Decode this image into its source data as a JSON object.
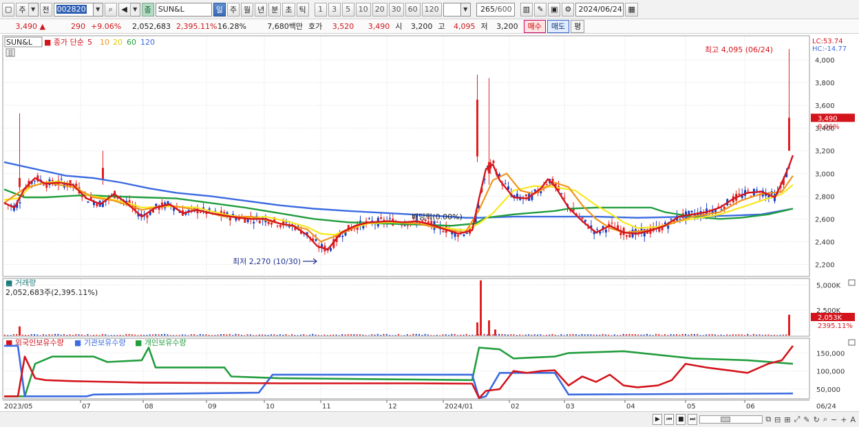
{
  "toolbar": {
    "mode_a": "주",
    "mode_b": "전",
    "stock_code": "002820",
    "type_badge": "종",
    "stock_name": "SUN&L",
    "periods": [
      "일",
      "주",
      "월",
      "년",
      "분",
      "초",
      "틱"
    ],
    "intervals": [
      "1",
      "3",
      "5",
      "10",
      "20",
      "30",
      "60",
      "120"
    ],
    "count": "265",
    "count_total": "/600",
    "date": "2024/06/24"
  },
  "quote": {
    "price": "3,490",
    "change": "290",
    "change_pct": "+9.06%",
    "volume": "2,052,683",
    "volume_pct": "2,395.11%",
    "turnover": "16.28%",
    "amount": "7,680백만",
    "ask_label": "호가",
    "ask": "3,520",
    "bid": "3,490",
    "open_label": "시",
    "open": "3,200",
    "high_label": "고",
    "high": "4,095",
    "low_label": "저",
    "low": "3,200",
    "buy": "매수",
    "sell": "매도",
    "avg": "평"
  },
  "legend": {
    "name": "SUN&L",
    "ma_title": "종가 단순",
    "ma": [
      {
        "period": "5",
        "color": "#d4141c"
      },
      {
        "period": "10",
        "color": "#f0941d"
      },
      {
        "period": "20",
        "color": "#f7e81e"
      },
      {
        "period": "60",
        "color": "#219d3c"
      },
      {
        "period": "120",
        "color": "#3a6ae0"
      }
    ]
  },
  "right_labels": {
    "lc": "LC:53.74",
    "hc": "HC:-14.77",
    "price_tag": "3,490",
    "pct_tag": "9.06%",
    "vol_tag": "2,053K",
    "vol_pct_tag": "2395.11%"
  },
  "annotations": {
    "high": "최고 4,095 (06/24)",
    "low": "최저 2,270 (10/30)",
    "dividend": "배당락(0.00%)"
  },
  "volume_panel": {
    "title": "거래량",
    "value": "2,052,683주(2,395.11%)",
    "ticks": [
      "5,000K",
      "2,500K"
    ]
  },
  "holding_panel": {
    "series": [
      {
        "name": "외국인보유수량",
        "color": "#d4141c"
      },
      {
        "name": "기관보유수량",
        "color": "#3a6ae0"
      },
      {
        "name": "개인보유수량",
        "color": "#219d3c"
      }
    ],
    "ticks": [
      "150,000",
      "100,000",
      "50,000"
    ]
  },
  "x_axis": [
    "2023/05",
    "07",
    "08",
    "09",
    "10",
    "11",
    "12",
    "2024/01",
    "02",
    "03",
    "04",
    "05",
    "06",
    "06/24"
  ],
  "chart_data": {
    "type": "candlestick",
    "price_axis": {
      "ticks": [
        4000,
        3800,
        3600,
        3400,
        3200,
        3000,
        2800,
        2600,
        2400,
        2200
      ],
      "ylim": [
        2100,
        4200
      ]
    },
    "ma120": [
      [
        0,
        3100
      ],
      [
        30,
        3060
      ],
      [
        60,
        3020
      ],
      [
        90,
        2980
      ],
      [
        130,
        2960
      ],
      [
        170,
        2920
      ],
      [
        210,
        2870
      ],
      [
        250,
        2830
      ],
      [
        300,
        2800
      ],
      [
        350,
        2760
      ],
      [
        400,
        2720
      ],
      [
        450,
        2690
      ],
      [
        500,
        2670
      ],
      [
        560,
        2650
      ],
      [
        620,
        2630
      ],
      [
        670,
        2610
      ],
      [
        690,
        2610
      ],
      [
        740,
        2620
      ],
      [
        800,
        2620
      ],
      [
        860,
        2620
      ],
      [
        920,
        2610
      ],
      [
        1000,
        2620
      ],
      [
        1060,
        2630
      ],
      [
        1100,
        2640
      ],
      [
        1146,
        2690
      ]
    ],
    "ma60": [
      [
        0,
        2860
      ],
      [
        30,
        2790
      ],
      [
        60,
        2790
      ],
      [
        90,
        2800
      ],
      [
        120,
        2810
      ],
      [
        150,
        2800
      ],
      [
        200,
        2790
      ],
      [
        250,
        2780
      ],
      [
        300,
        2740
      ],
      [
        350,
        2700
      ],
      [
        400,
        2650
      ],
      [
        450,
        2600
      ],
      [
        500,
        2570
      ],
      [
        550,
        2560
      ],
      [
        600,
        2550
      ],
      [
        650,
        2540
      ],
      [
        685,
        2560
      ],
      [
        700,
        2610
      ],
      [
        740,
        2640
      ],
      [
        800,
        2670
      ],
      [
        820,
        2690
      ],
      [
        860,
        2700
      ],
      [
        900,
        2700
      ],
      [
        940,
        2700
      ],
      [
        960,
        2660
      ],
      [
        1000,
        2620
      ],
      [
        1040,
        2600
      ],
      [
        1070,
        2610
      ],
      [
        1110,
        2640
      ],
      [
        1146,
        2690
      ]
    ],
    "ma20": [
      [
        0,
        2770
      ],
      [
        20,
        2780
      ],
      [
        40,
        2890
      ],
      [
        60,
        2920
      ],
      [
        80,
        2930
      ],
      [
        100,
        2900
      ],
      [
        120,
        2810
      ],
      [
        150,
        2780
      ],
      [
        180,
        2740
      ],
      [
        200,
        2700
      ],
      [
        240,
        2710
      ],
      [
        280,
        2700
      ],
      [
        320,
        2640
      ],
      [
        350,
        2610
      ],
      [
        380,
        2620
      ],
      [
        410,
        2580
      ],
      [
        440,
        2530
      ],
      [
        460,
        2470
      ],
      [
        480,
        2460
      ],
      [
        500,
        2510
      ],
      [
        530,
        2560
      ],
      [
        560,
        2570
      ],
      [
        600,
        2560
      ],
      [
        640,
        2520
      ],
      [
        670,
        2500
      ],
      [
        690,
        2560
      ],
      [
        710,
        2650
      ],
      [
        740,
        2850
      ],
      [
        770,
        2890
      ],
      [
        800,
        2880
      ],
      [
        830,
        2850
      ],
      [
        860,
        2720
      ],
      [
        880,
        2650
      ],
      [
        900,
        2570
      ],
      [
        920,
        2520
      ],
      [
        950,
        2530
      ],
      [
        980,
        2580
      ],
      [
        1000,
        2600
      ],
      [
        1040,
        2640
      ],
      [
        1080,
        2720
      ],
      [
        1110,
        2780
      ],
      [
        1130,
        2820
      ],
      [
        1146,
        2900
      ]
    ],
    "ma10": [
      [
        0,
        2740
      ],
      [
        30,
        2870
      ],
      [
        60,
        2920
      ],
      [
        100,
        2880
      ],
      [
        130,
        2790
      ],
      [
        160,
        2760
      ],
      [
        200,
        2680
      ],
      [
        240,
        2720
      ],
      [
        280,
        2680
      ],
      [
        320,
        2620
      ],
      [
        360,
        2620
      ],
      [
        400,
        2560
      ],
      [
        440,
        2510
      ],
      [
        460,
        2400
      ],
      [
        490,
        2470
      ],
      [
        520,
        2560
      ],
      [
        560,
        2580
      ],
      [
        600,
        2560
      ],
      [
        640,
        2510
      ],
      [
        670,
        2480
      ],
      [
        690,
        2680
      ],
      [
        710,
        2940
      ],
      [
        730,
        3000
      ],
      [
        750,
        2850
      ],
      [
        770,
        2820
      ],
      [
        800,
        2920
      ],
      [
        820,
        2880
      ],
      [
        840,
        2720
      ],
      [
        860,
        2600
      ],
      [
        880,
        2520
      ],
      [
        900,
        2480
      ],
      [
        940,
        2500
      ],
      [
        970,
        2560
      ],
      [
        1000,
        2620
      ],
      [
        1040,
        2660
      ],
      [
        1070,
        2760
      ],
      [
        1100,
        2820
      ],
      [
        1130,
        2840
      ],
      [
        1146,
        2980
      ]
    ],
    "ma5": [
      [
        0,
        2740
      ],
      [
        15,
        2700
      ],
      [
        30,
        2870
      ],
      [
        45,
        2960
      ],
      [
        60,
        2910
      ],
      [
        80,
        2920
      ],
      [
        100,
        2900
      ],
      [
        120,
        2780
      ],
      [
        140,
        2730
      ],
      [
        160,
        2820
      ],
      [
        180,
        2730
      ],
      [
        200,
        2620
      ],
      [
        220,
        2700
      ],
      [
        240,
        2730
      ],
      [
        260,
        2650
      ],
      [
        280,
        2680
      ],
      [
        300,
        2650
      ],
      [
        320,
        2630
      ],
      [
        340,
        2610
      ],
      [
        360,
        2600
      ],
      [
        380,
        2600
      ],
      [
        400,
        2560
      ],
      [
        420,
        2540
      ],
      [
        440,
        2460
      ],
      [
        455,
        2360
      ],
      [
        470,
        2330
      ],
      [
        490,
        2480
      ],
      [
        510,
        2540
      ],
      [
        530,
        2570
      ],
      [
        560,
        2580
      ],
      [
        580,
        2570
      ],
      [
        600,
        2580
      ],
      [
        620,
        2550
      ],
      [
        640,
        2510
      ],
      [
        660,
        2470
      ],
      [
        680,
        2500
      ],
      [
        690,
        2780
      ],
      [
        700,
        3040
      ],
      [
        710,
        3080
      ],
      [
        720,
        2940
      ],
      [
        740,
        2790
      ],
      [
        760,
        2780
      ],
      [
        780,
        2870
      ],
      [
        790,
        2950
      ],
      [
        800,
        2890
      ],
      [
        820,
        2700
      ],
      [
        840,
        2580
      ],
      [
        860,
        2480
      ],
      [
        880,
        2540
      ],
      [
        900,
        2480
      ],
      [
        920,
        2470
      ],
      [
        940,
        2500
      ],
      [
        960,
        2540
      ],
      [
        980,
        2620
      ],
      [
        1000,
        2640
      ],
      [
        1020,
        2660
      ],
      [
        1040,
        2700
      ],
      [
        1060,
        2780
      ],
      [
        1080,
        2830
      ],
      [
        1100,
        2840
      ],
      [
        1120,
        2790
      ],
      [
        1130,
        2920
      ],
      [
        1140,
        3060
      ],
      [
        1146,
        3160
      ]
    ],
    "volume": {
      "max_k": 5500,
      "last_k": 2053
    },
    "holdings": {
      "foreign": [
        [
          0,
          30000
        ],
        [
          20,
          30000
        ],
        [
          30,
          140000
        ],
        [
          45,
          80000
        ],
        [
          60,
          75000
        ],
        [
          100,
          72000
        ],
        [
          200,
          68000
        ],
        [
          400,
          66000
        ],
        [
          600,
          66000
        ],
        [
          680,
          65000
        ],
        [
          690,
          25000
        ],
        [
          700,
          45000
        ],
        [
          720,
          50000
        ],
        [
          740,
          100000
        ],
        [
          760,
          95000
        ],
        [
          780,
          100000
        ],
        [
          800,
          102000
        ],
        [
          820,
          60000
        ],
        [
          840,
          85000
        ],
        [
          860,
          70000
        ],
        [
          880,
          90000
        ],
        [
          900,
          60000
        ],
        [
          920,
          55000
        ],
        [
          950,
          60000
        ],
        [
          970,
          75000
        ],
        [
          990,
          120000
        ],
        [
          1020,
          110000
        ],
        [
          1060,
          100000
        ],
        [
          1080,
          95000
        ],
        [
          1110,
          120000
        ],
        [
          1130,
          130000
        ],
        [
          1146,
          170000
        ]
      ],
      "institution": [
        [
          0,
          170000
        ],
        [
          20,
          170000
        ],
        [
          30,
          30000
        ],
        [
          120,
          30000
        ],
        [
          130,
          35000
        ],
        [
          370,
          40000
        ],
        [
          390,
          90000
        ],
        [
          680,
          90000
        ],
        [
          690,
          25000
        ],
        [
          700,
          30000
        ],
        [
          720,
          95000
        ],
        [
          800,
          95000
        ],
        [
          820,
          35000
        ],
        [
          1146,
          38000
        ]
      ],
      "individual": [
        [
          0,
          30000
        ],
        [
          30,
          30000
        ],
        [
          45,
          120000
        ],
        [
          70,
          140000
        ],
        [
          130,
          140000
        ],
        [
          150,
          125000
        ],
        [
          200,
          130000
        ],
        [
          210,
          165000
        ],
        [
          220,
          110000
        ],
        [
          320,
          110000
        ],
        [
          330,
          85000
        ],
        [
          400,
          80000
        ],
        [
          680,
          75000
        ],
        [
          690,
          165000
        ],
        [
          720,
          160000
        ],
        [
          740,
          135000
        ],
        [
          800,
          140000
        ],
        [
          820,
          150000
        ],
        [
          900,
          155000
        ],
        [
          1000,
          135000
        ],
        [
          1080,
          130000
        ],
        [
          1146,
          120000
        ]
      ]
    }
  }
}
